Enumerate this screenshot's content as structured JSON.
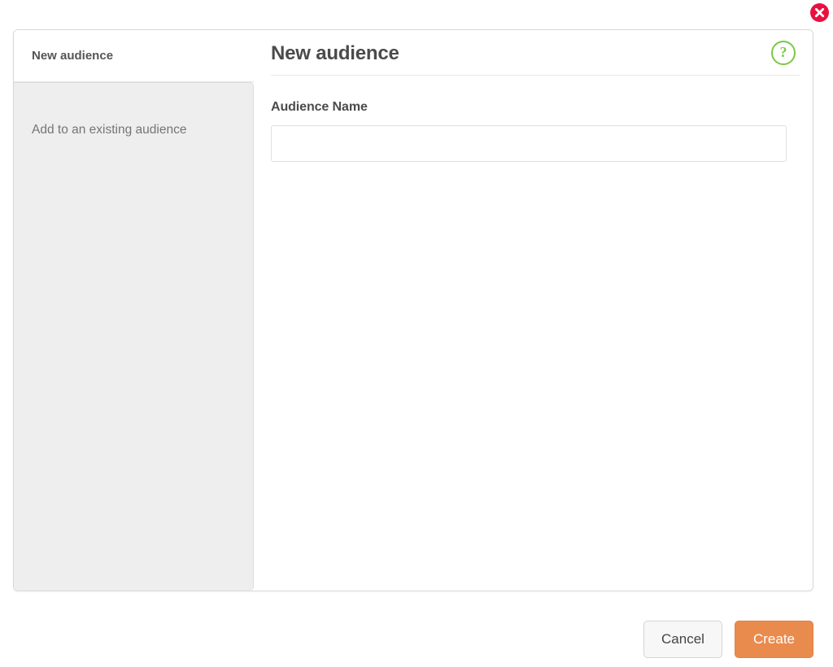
{
  "window": {
    "close_label": "close-icon"
  },
  "sidebar": {
    "tabs": [
      {
        "label": "New audience",
        "state": "active"
      },
      {
        "label": "Add to an existing audience",
        "state": "inactive"
      }
    ]
  },
  "main": {
    "title": "New audience",
    "help_glyph": "?",
    "form": {
      "audience_name_label": "Audience Name",
      "audience_name_value": "",
      "audience_name_placeholder": ""
    }
  },
  "footer": {
    "cancel_label": "Cancel",
    "create_label": "Create"
  },
  "colors": {
    "close_red": "#e8103f",
    "help_green": "#7ac943",
    "create_orange": "#ea8b4e",
    "sidebar_gray": "#eeeeee",
    "text_dark": "#4b4b4b",
    "text_muted": "#757575"
  }
}
